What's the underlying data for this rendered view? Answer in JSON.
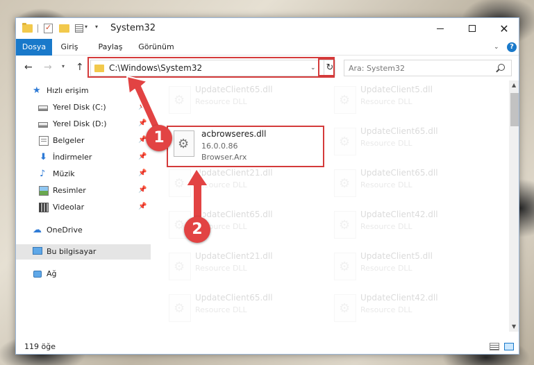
{
  "window": {
    "title": "System32",
    "accent": "#1979ca"
  },
  "ribbon": {
    "tabs": [
      {
        "label": "Dosya"
      },
      {
        "label": "Giriş"
      },
      {
        "label": "Paylaş"
      },
      {
        "label": "Görünüm"
      }
    ]
  },
  "nav": {
    "address": "C:\\Windows\\System32",
    "search_placeholder": "Ara: System32"
  },
  "sidebar": {
    "items": [
      {
        "label": "Hızlı erişim",
        "icon": "star-icon"
      },
      {
        "label": "Yerel Disk (C:)",
        "icon": "disk-icon"
      },
      {
        "label": "Yerel Disk (D:)",
        "icon": "disk-icon"
      },
      {
        "label": "Belgeler",
        "icon": "document-icon"
      },
      {
        "label": "İndirmeler",
        "icon": "download-icon"
      },
      {
        "label": "Müzik",
        "icon": "music-icon"
      },
      {
        "label": "Resimler",
        "icon": "pictures-icon"
      },
      {
        "label": "Videolar",
        "icon": "video-icon"
      },
      {
        "label": "OneDrive",
        "icon": "cloud-icon"
      },
      {
        "label": "Bu bilgisayar",
        "icon": "computer-icon"
      },
      {
        "label": "Ağ",
        "icon": "network-icon"
      }
    ]
  },
  "files": {
    "left": [
      {
        "name": "UpdateClient65.dll",
        "type": "Resource DLL"
      },
      {
        "name": "UpdateClient21.dll",
        "type": "Resource DLL"
      },
      {
        "name": "UpdateClient65.dll",
        "type": "Resource DLL"
      },
      {
        "name": "UpdateClient21.dll",
        "type": "Resource DLL"
      },
      {
        "name": "UpdateClient65.dll",
        "type": "Resource DLL"
      }
    ],
    "right": [
      {
        "name": "UpdateClient5.dll",
        "type": "Resource DLL"
      },
      {
        "name": "UpdateClient65.dll",
        "type": "Resource DLL"
      },
      {
        "name": "UpdateClient65.dll",
        "type": "Resource DLL"
      },
      {
        "name": "UpdateClient42.dll",
        "type": "Resource DLL"
      },
      {
        "name": "UpdateClient5.dll",
        "type": "Resource DLL"
      },
      {
        "name": "UpdateClient42.dll",
        "type": "Resource DLL"
      }
    ],
    "highlighted": {
      "name": "acbrowseres.dll",
      "version": "16.0.0.86",
      "description": "Browser.Arx"
    }
  },
  "status": {
    "count": "119 öğe"
  },
  "annotations": {
    "badge_1": "1",
    "badge_2": "2",
    "color": "#d43a3a"
  }
}
